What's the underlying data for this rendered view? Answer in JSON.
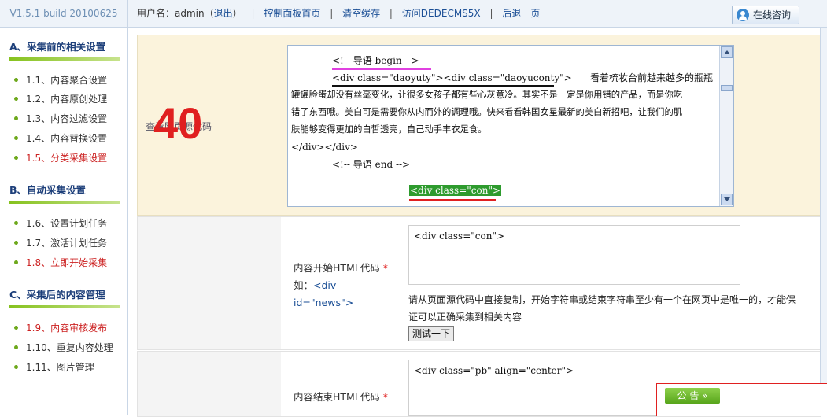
{
  "header": {
    "version": "V1.5.1 build 20100625",
    "user_label": "用户名：admin",
    "logout": "退出",
    "links": [
      "控制面板首页",
      "清空缓存",
      "访问DEDECMS5X",
      "后退一页"
    ],
    "consult_button": "在线咨询"
  },
  "sidebar": {
    "sections": [
      {
        "title": "A、采集前的相关设置",
        "items": [
          {
            "label": "1.1、内容聚合设置",
            "highlight": false
          },
          {
            "label": "1.2、内容原创处理",
            "highlight": false
          },
          {
            "label": "1.3、内容过滤设置",
            "highlight": false
          },
          {
            "label": "1.4、内容替换设置",
            "highlight": false
          },
          {
            "label": "1.5、分类采集设置",
            "highlight": true
          }
        ]
      },
      {
        "title": "B、自动采集设置",
        "items": [
          {
            "label": "1.6、设置计划任务",
            "highlight": false
          },
          {
            "label": "1.7、激活计划任务",
            "highlight": false
          },
          {
            "label": "1.8、立即开始采集",
            "highlight": true
          }
        ]
      },
      {
        "title": "C、采集后的内容管理",
        "items": [
          {
            "label": "1.9、内容审核发布",
            "highlight": true
          },
          {
            "label": "1.10、重复内容处理",
            "highlight": false
          },
          {
            "label": "1.11、图片管理",
            "highlight": false
          }
        ]
      }
    ]
  },
  "row1": {
    "overlay_number": "40",
    "label": "查看网页源代码",
    "source_lines": [
      "<!-- 导语 begin -->",
      "<div class=\"daoyuty\"><div class=\"daoyuconty\">",
      "看着梳妆台前越来越多的瓶瓶",
      "罐罐脸蛋却没有丝毫变化，让很多女孩子都有些心灰意冷。其实不是一定是你用错的产品，而是你吃",
      "错了东西哦。美白可是需要你从内而外的调理哦。快来看看韩国女星最新的美白新招吧，让我们的肌",
      "肤能够变得更加的白皙透亮，自己动手丰衣足食。",
      "</div></div>",
      "<!-- 导语 end -->",
      "<div class=\"con\">"
    ]
  },
  "row2": {
    "label": "内容开始HTML代码",
    "required_mark": "*",
    "example_prefix": "如：",
    "example_code": "<div id=\"news\">",
    "example_code_line1": "<div",
    "example_code_line2": "id=\"news\">",
    "textarea_value": "<div class=\"con\">",
    "hint_line1": "请从页面源代码中直接复制，开始字符串或结束字符串至少有一个在网页中是唯一的，才能保",
    "hint_line2": "证可以正确采集到相关内容",
    "test_button": "测试一下"
  },
  "row3": {
    "label": "内容结束HTML代码",
    "required_mark": "*",
    "textarea_value": "<div class=\"pb\" align=\"center\">"
  },
  "notice": {
    "tab_label": "公 告 »"
  }
}
